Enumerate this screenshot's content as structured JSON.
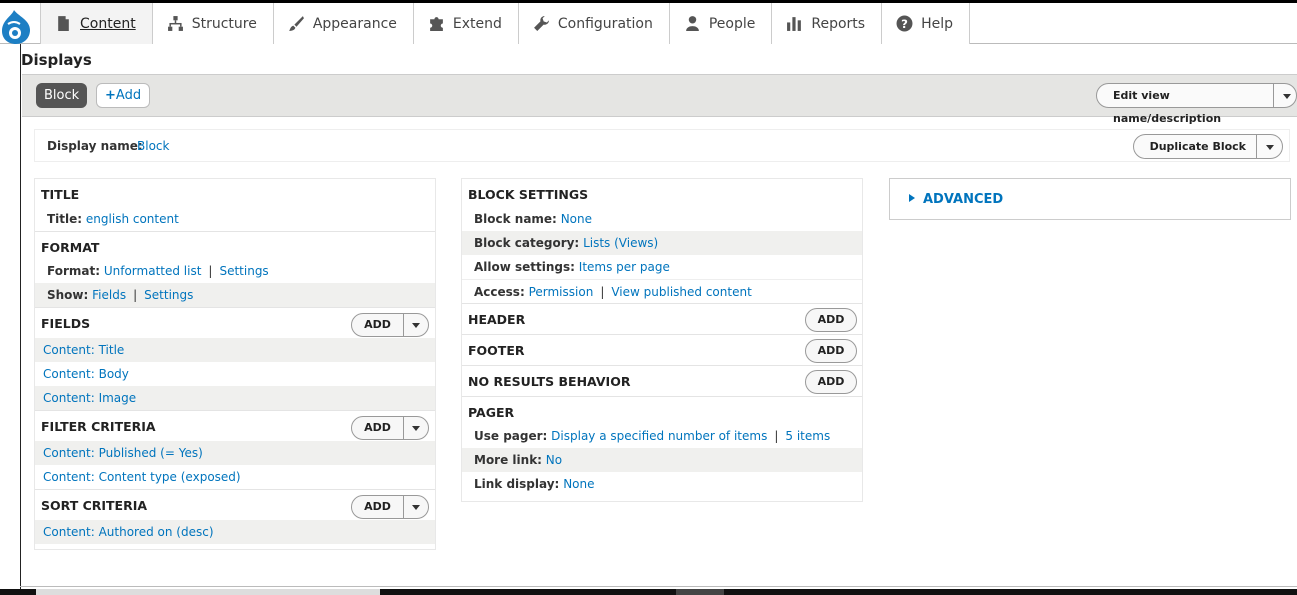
{
  "toolbar": {
    "tabs": [
      {
        "label": "Content",
        "icon": "file-icon",
        "active": true
      },
      {
        "label": "Structure",
        "icon": "sitemap-icon"
      },
      {
        "label": "Appearance",
        "icon": "paintbrush-icon"
      },
      {
        "label": "Extend",
        "icon": "puzzle-icon"
      },
      {
        "label": "Configuration",
        "icon": "wrench-icon"
      },
      {
        "label": "People",
        "icon": "person-icon"
      },
      {
        "label": "Reports",
        "icon": "bar-chart-icon"
      },
      {
        "label": "Help",
        "icon": "help-icon"
      }
    ]
  },
  "page": {
    "title": "Displays"
  },
  "displays": {
    "active": "Block",
    "add": "Add",
    "edit_button": "Edit view name/description"
  },
  "display_name": {
    "label": "Display name:",
    "value": "Block",
    "duplicate_button": "Duplicate Block"
  },
  "left": {
    "title": {
      "header": "TITLE",
      "label": "Title:",
      "value": "english content"
    },
    "format": {
      "header": "FORMAT",
      "format_label": "Format:",
      "format_value": "Unformatted list",
      "format_settings": "Settings",
      "show_label": "Show:",
      "show_value": "Fields",
      "show_settings": "Settings"
    },
    "fields": {
      "header": "FIELDS",
      "add": "Add",
      "items": [
        "Content: Title",
        "Content: Body",
        "Content: Image"
      ]
    },
    "filter": {
      "header": "FILTER CRITERIA",
      "add": "Add",
      "items": [
        "Content: Published (= Yes)",
        "Content: Content type (exposed)"
      ]
    },
    "sort": {
      "header": "SORT CRITERIA",
      "add": "Add",
      "items": [
        "Content: Authored on (desc)"
      ]
    }
  },
  "middle": {
    "block_settings": {
      "header": "BLOCK SETTINGS",
      "name_label": "Block name:",
      "name_value": "None",
      "category_label": "Block category:",
      "category_value": "Lists (Views)",
      "allow_label": "Allow settings:",
      "allow_value": "Items per page",
      "access_label": "Access:",
      "access_value": "Permission",
      "access_extra": "View published content"
    },
    "header_sec": {
      "header": "HEADER",
      "add": "Add"
    },
    "footer_sec": {
      "header": "FOOTER",
      "add": "Add"
    },
    "no_results": {
      "header": "NO RESULTS BEHAVIOR",
      "add": "Add"
    },
    "pager": {
      "header": "PAGER",
      "use_label": "Use pager:",
      "use_value": "Display a specified number of items",
      "use_extra": "5 items",
      "more_label": "More link:",
      "more_value": "No",
      "link_label": "Link display:",
      "link_value": "None"
    }
  },
  "advanced": {
    "label": "ADVANCED"
  }
}
